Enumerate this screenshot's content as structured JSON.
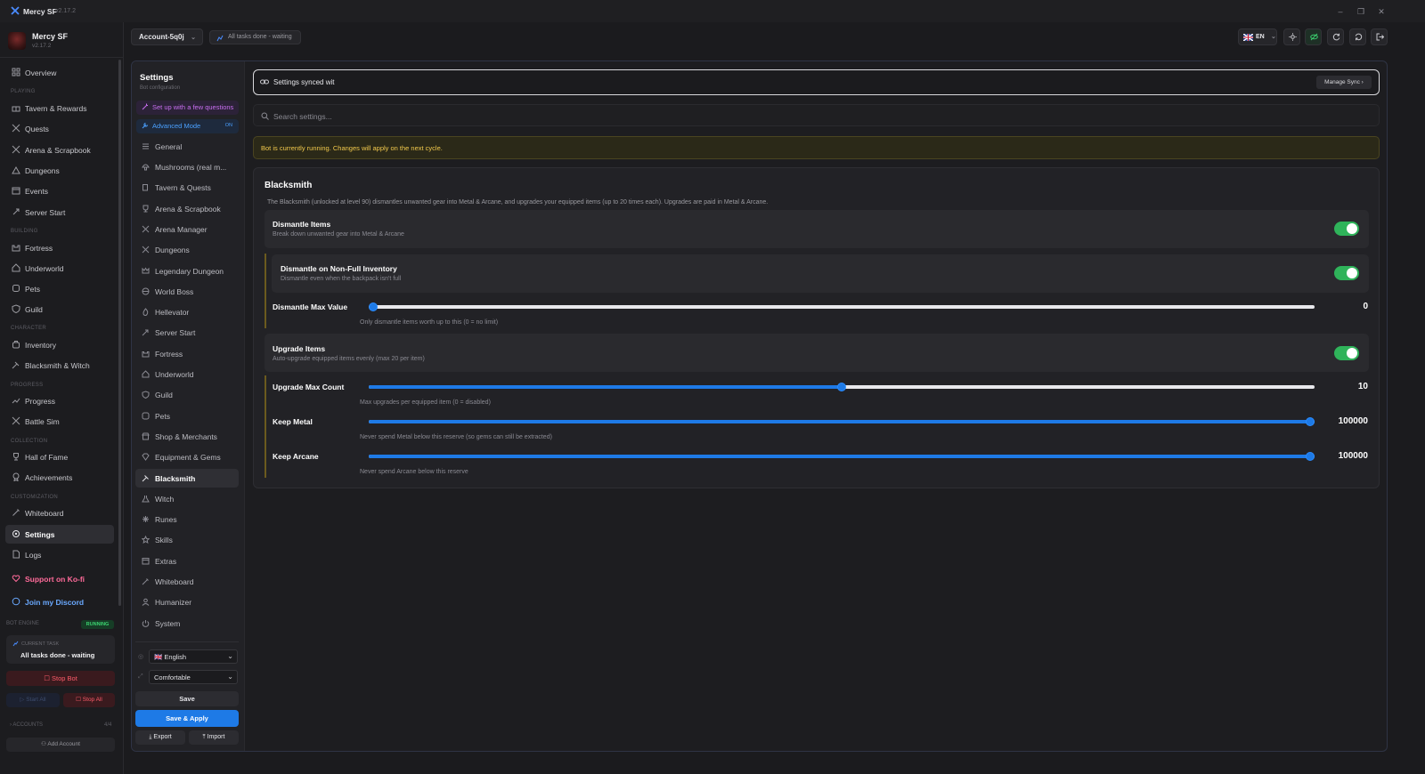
{
  "app": {
    "name": "Mercy SF",
    "version": "v2.17.2"
  },
  "profile": {
    "name": "Mercy SF",
    "version": "v2.17.2"
  },
  "sidebar": {
    "items": [
      {
        "label": "Overview",
        "icon": "grid-icon"
      },
      {
        "label": "Tavern & Rewards",
        "icon": "gift-icon"
      },
      {
        "label": "Quests",
        "icon": "swords-icon"
      },
      {
        "label": "Arena & Scrapbook",
        "icon": "swords-icon"
      },
      {
        "label": "Dungeons",
        "icon": "mountain-icon"
      },
      {
        "label": "Events",
        "icon": "calendar-icon"
      },
      {
        "label": "Server Start",
        "icon": "rocket-icon"
      },
      {
        "label": "Fortress",
        "icon": "castle-icon"
      },
      {
        "label": "Underworld",
        "icon": "skull-icon"
      },
      {
        "label": "Pets",
        "icon": "paw-icon"
      },
      {
        "label": "Guild",
        "icon": "shield-icon"
      },
      {
        "label": "Inventory",
        "icon": "backpack-icon"
      },
      {
        "label": "Blacksmith & Witch",
        "icon": "hammer-icon"
      },
      {
        "label": "Progress",
        "icon": "trending-icon"
      },
      {
        "label": "Battle Sim",
        "icon": "swords-icon"
      },
      {
        "label": "Hall of Fame",
        "icon": "trophy-icon"
      },
      {
        "label": "Achievements",
        "icon": "medal-icon"
      },
      {
        "label": "Whiteboard",
        "icon": "pen-icon"
      },
      {
        "label": "Settings",
        "icon": "gear-icon"
      },
      {
        "label": "Logs",
        "icon": "file-icon"
      },
      {
        "label": "Support on Ko-fi",
        "icon": "heart-icon"
      },
      {
        "label": "Join my Discord",
        "icon": "chat-icon"
      }
    ],
    "sections": [
      "PLAYING",
      "BUILDING",
      "CHARACTER",
      "PROGRESS",
      "COLLECTION",
      "CUSTOMIZATION"
    ],
    "engine": {
      "label": "BOT ENGINE",
      "status": "RUNNING",
      "task_label": "CURRENT TASK",
      "task_value": "All tasks done - waiting",
      "stop_bot": "Stop Bot",
      "start_all": "Start All",
      "stop_all": "Stop All"
    },
    "accounts": {
      "label": "ACCOUNTS",
      "count": "4/4",
      "add": "Add Account"
    }
  },
  "header": {
    "account": "Account-5q0j",
    "status": "All tasks done - waiting",
    "lang": "EN"
  },
  "settings_nav": {
    "title": "Settings",
    "subtitle": "Bot configuration",
    "setup": "Set up with a few questions",
    "advanced": "Advanced Mode",
    "advanced_state": "ON",
    "items": [
      {
        "label": "General",
        "icon": "sliders-icon"
      },
      {
        "label": "Mushrooms (real m...",
        "icon": "mushroom-icon"
      },
      {
        "label": "Tavern & Quests",
        "icon": "beer-icon"
      },
      {
        "label": "Arena & Scrapbook",
        "icon": "trophy-icon"
      },
      {
        "label": "Arena Manager",
        "icon": "swords-icon"
      },
      {
        "label": "Dungeons",
        "icon": "swords-icon"
      },
      {
        "label": "Legendary Dungeon",
        "icon": "crown-icon"
      },
      {
        "label": "World Boss",
        "icon": "globe-icon"
      },
      {
        "label": "Hellevator",
        "icon": "flame-icon"
      },
      {
        "label": "Server Start",
        "icon": "rocket-icon"
      },
      {
        "label": "Fortress",
        "icon": "castle-icon"
      },
      {
        "label": "Underworld",
        "icon": "skull-icon"
      },
      {
        "label": "Guild",
        "icon": "shield-icon"
      },
      {
        "label": "Pets",
        "icon": "paw-icon"
      },
      {
        "label": "Shop & Merchants",
        "icon": "store-icon"
      },
      {
        "label": "Equipment & Gems",
        "icon": "gem-icon"
      },
      {
        "label": "Blacksmith",
        "icon": "hammer-icon"
      },
      {
        "label": "Witch",
        "icon": "flask-icon"
      },
      {
        "label": "Runes",
        "icon": "sparkles-icon"
      },
      {
        "label": "Skills",
        "icon": "star-icon"
      },
      {
        "label": "Extras",
        "icon": "box-icon"
      },
      {
        "label": "Whiteboard",
        "icon": "pen-icon"
      },
      {
        "label": "Humanizer",
        "icon": "user-icon"
      },
      {
        "label": "System",
        "icon": "power-icon"
      }
    ],
    "language_select": "🇬🇧 English",
    "density_select": "Comfortable",
    "save": "Save",
    "save_apply": "Save & Apply",
    "export": "Export",
    "import": "Import"
  },
  "content": {
    "sync_text": "Settings synced wit",
    "manage_sync": "Manage Sync",
    "search_placeholder": "Search settings...",
    "warning": "Bot is currently running. Changes will apply on the next cycle.",
    "section": {
      "title": "Blacksmith",
      "description": "The Blacksmith (unlocked at level 90) dismantles unwanted gear into Metal & Arcane, and upgrades your equipped items (up to 20 times each). Upgrades are paid in Metal & Arcane.",
      "dismantle": {
        "title": "Dismantle Items",
        "sub": "Break down unwanted gear into Metal & Arcane",
        "enabled": true
      },
      "dismantle_nonfull": {
        "title": "Dismantle on Non-Full Inventory",
        "sub": "Dismantle even when the backpack isn't full",
        "enabled": true
      },
      "dismantle_max": {
        "label": "Dismantle Max Value",
        "value": "0",
        "fraction": 0.0,
        "help": "Only dismantle items worth up to this (0 = no limit)"
      },
      "upgrade": {
        "title": "Upgrade Items",
        "sub": "Auto-upgrade equipped items evenly (max 20 per item)",
        "enabled": true
      },
      "upgrade_max": {
        "label": "Upgrade Max Count",
        "value": "10",
        "fraction": 0.5,
        "help": "Max upgrades per equipped item (0 = disabled)"
      },
      "keep_metal": {
        "label": "Keep Metal",
        "value": "100000",
        "fraction": 1.0,
        "help": "Never spend Metal below this reserve (so gems can still be extracted)"
      },
      "keep_arcane": {
        "label": "Keep Arcane",
        "value": "100000",
        "fraction": 1.0,
        "help": "Never spend Arcane below this reserve"
      }
    }
  },
  "colors": {
    "accent": "#1e7ae6",
    "toggle_on": "#2fb35a",
    "warning": "#f2c94c",
    "danger": "#ff5c6a"
  }
}
